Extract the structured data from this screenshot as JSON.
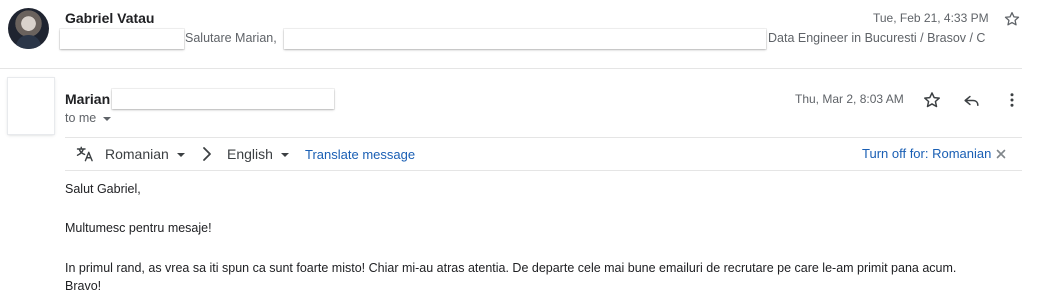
{
  "collapsed_message": {
    "sender": "Gabriel Vatau",
    "snippet_part1": "Salutare Marian,",
    "snippet_part2": "Data Engineer in Bucuresti / Brasov / C",
    "date": "Tue, Feb 21, 4:33 PM"
  },
  "open_message": {
    "sender": "Marian",
    "recipient": "to me",
    "date": "Thu, Mar 2, 8:03 AM"
  },
  "translate_bar": {
    "source_language": "Romanian",
    "target_language": "English",
    "translate_label": "Translate message",
    "turn_off_label": "Turn off for: Romanian"
  },
  "body": {
    "greeting": "Salut Gabriel,",
    "line1": "Multumesc pentru mesaje!",
    "line2": "In primul rand, as vrea sa iti spun ca sunt foarte misto! Chiar mi-au atras atentia. De departe cele mai bune emailuri de recrutare pe care le-am primit pana acum.",
    "line3": "Bravo!"
  },
  "colors": {
    "link": "#1a5fb4",
    "muted": "#5f6368",
    "text": "#202124"
  }
}
